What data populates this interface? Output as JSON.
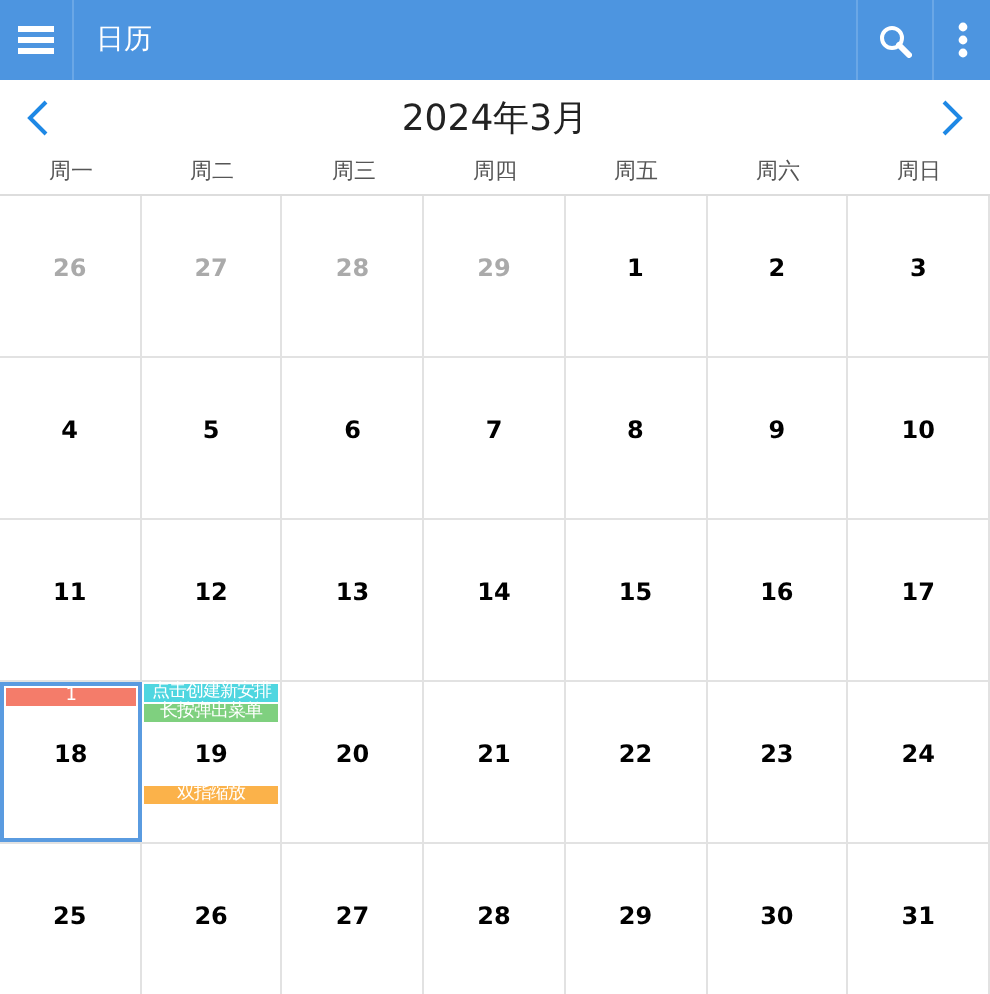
{
  "app_bar": {
    "title": "日历"
  },
  "month_nav": {
    "title": "2024年3月"
  },
  "weekdays": [
    "周一",
    "周二",
    "周三",
    "周四",
    "周五",
    "周六",
    "周日"
  ],
  "weeks": [
    [
      {
        "day": "26",
        "muted": true,
        "selected": false
      },
      {
        "day": "27",
        "muted": true,
        "selected": false
      },
      {
        "day": "28",
        "muted": true,
        "selected": false
      },
      {
        "day": "29",
        "muted": true,
        "selected": false
      },
      {
        "day": "1",
        "muted": false,
        "selected": false
      },
      {
        "day": "2",
        "muted": false,
        "selected": false
      },
      {
        "day": "3",
        "muted": false,
        "selected": false
      }
    ],
    [
      {
        "day": "4",
        "muted": false,
        "selected": false
      },
      {
        "day": "5",
        "muted": false,
        "selected": false
      },
      {
        "day": "6",
        "muted": false,
        "selected": false
      },
      {
        "day": "7",
        "muted": false,
        "selected": false
      },
      {
        "day": "8",
        "muted": false,
        "selected": false
      },
      {
        "day": "9",
        "muted": false,
        "selected": false
      },
      {
        "day": "10",
        "muted": false,
        "selected": false
      }
    ],
    [
      {
        "day": "11",
        "muted": false,
        "selected": false
      },
      {
        "day": "12",
        "muted": false,
        "selected": false
      },
      {
        "day": "13",
        "muted": false,
        "selected": false
      },
      {
        "day": "14",
        "muted": false,
        "selected": false
      },
      {
        "day": "15",
        "muted": false,
        "selected": false
      },
      {
        "day": "16",
        "muted": false,
        "selected": false
      },
      {
        "day": "17",
        "muted": false,
        "selected": false
      }
    ],
    [
      {
        "day": "18",
        "muted": false,
        "selected": true,
        "events": [
          {
            "text": "1",
            "color": "#f47c6a",
            "kind": "top"
          }
        ]
      },
      {
        "day": "19",
        "muted": false,
        "selected": false,
        "events": [
          {
            "text": "点击创建新安排",
            "color": "#4fd6e0",
            "kind": "top"
          },
          {
            "text": "长按弹出菜单",
            "color": "#7fd07f",
            "kind": "top"
          },
          {
            "text": "双指缩放",
            "color": "#fbb24a",
            "kind": "bottom"
          }
        ]
      },
      {
        "day": "20",
        "muted": false,
        "selected": false
      },
      {
        "day": "21",
        "muted": false,
        "selected": false
      },
      {
        "day": "22",
        "muted": false,
        "selected": false
      },
      {
        "day": "23",
        "muted": false,
        "selected": false
      },
      {
        "day": "24",
        "muted": false,
        "selected": false
      }
    ],
    [
      {
        "day": "25",
        "muted": false,
        "selected": false
      },
      {
        "day": "26",
        "muted": false,
        "selected": false
      },
      {
        "day": "27",
        "muted": false,
        "selected": false
      },
      {
        "day": "28",
        "muted": false,
        "selected": false
      },
      {
        "day": "29",
        "muted": false,
        "selected": false
      },
      {
        "day": "30",
        "muted": false,
        "selected": false
      },
      {
        "day": "31",
        "muted": false,
        "selected": false
      }
    ]
  ]
}
